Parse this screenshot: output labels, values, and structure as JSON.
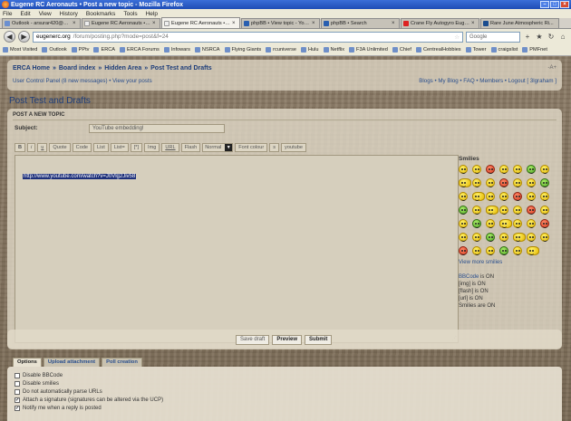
{
  "window": {
    "title": "Eugene RC Aeronauts • Post a new topic - Mozilla Firefox"
  },
  "menu": [
    "File",
    "Edit",
    "View",
    "History",
    "Bookmarks",
    "Tools",
    "Help"
  ],
  "tabs": [
    {
      "label": "Outlook - arsurar420@hot...",
      "icon": "mail-icon",
      "active": false
    },
    {
      "label": "Eugene RC Aeronauts • P...",
      "icon": "erca-icon",
      "active": false
    },
    {
      "label": "Eugene RC Aeronauts • P...",
      "icon": "erca-icon",
      "active": true
    },
    {
      "label": "phpBB • View topic - YouT...",
      "icon": "phpbb-icon",
      "active": false
    },
    {
      "label": "phpBB • Search",
      "icon": "phpbb-icon",
      "active": false
    },
    {
      "label": "Crane Fly Autogyro Euge...",
      "icon": "youtube-icon",
      "active": false
    },
    {
      "label": "Rare June Atmospheric Ri...",
      "icon": "noaa-icon",
      "active": false
    }
  ],
  "nav": {
    "url_site": "eugenerc.org",
    "url_rest": "/forum/posting.php?mode=post&f=24",
    "search_placeholder": "Google"
  },
  "bookmarks": [
    "Most Visited",
    "Outlook",
    "PPtv",
    "ERCA",
    "ERCA Forums",
    "Infowars",
    "NSRCA",
    "Flying Giants",
    "rcuniverse",
    "Hulu",
    "Netflix",
    "F3A Unlimited",
    "Chief",
    "CentrealHobbies",
    "Tower",
    "craigslist",
    "PMFnet"
  ],
  "header": {
    "crumbs": [
      "ERCA Home",
      "»",
      "Board index",
      "»",
      "Hidden Area",
      "»",
      "Post Test and Drafts"
    ],
    "ucp_link": "User Control Panel (8 new messages) • View your posts",
    "user_links": "Blogs • My Blog • FAQ • Members • Logout [ 3lgraham ]",
    "fontsize": "-A+"
  },
  "page_title": "Post Test and Drafts",
  "post": {
    "heading": "POST A NEW TOPIC",
    "subject_label": "Subject:",
    "subject_value": "YouTube embedding!",
    "toolbar": [
      "B",
      "i",
      "u",
      "Quote",
      "Code",
      "List",
      "List=",
      "[*]",
      "Img",
      "URL",
      "Flash"
    ],
    "size_select": "Normal",
    "toolbar_right": [
      "Font colour",
      "s",
      "youtube"
    ],
    "body_text": "http://www.youtube.com/watch?v=J0Vlg2Jiv58"
  },
  "smilies": {
    "title": "Smilies",
    "count": 48,
    "more_link": "View more smilies",
    "bb_link": "BBCode",
    "bb_status": "is ON",
    "img": "[img] is ON",
    "flash": "[flash] is ON",
    "url": "[url] is ON",
    "smilies_status": "Smilies are ON"
  },
  "actions": {
    "save_draft": "Save draft",
    "preview": "Preview",
    "submit": "Submit"
  },
  "options_tabs": [
    "Options",
    "Upload attachment",
    "Poll creation"
  ],
  "options": [
    {
      "label": "Disable BBCode",
      "checked": false
    },
    {
      "label": "Disable smilies",
      "checked": false
    },
    {
      "label": "Do not automatically parse URLs",
      "checked": false
    },
    {
      "label": "Attach a signature (signatures can be altered via the UCP)",
      "checked": true
    },
    {
      "label": "Notify me when a reply is posted",
      "checked": true
    }
  ]
}
